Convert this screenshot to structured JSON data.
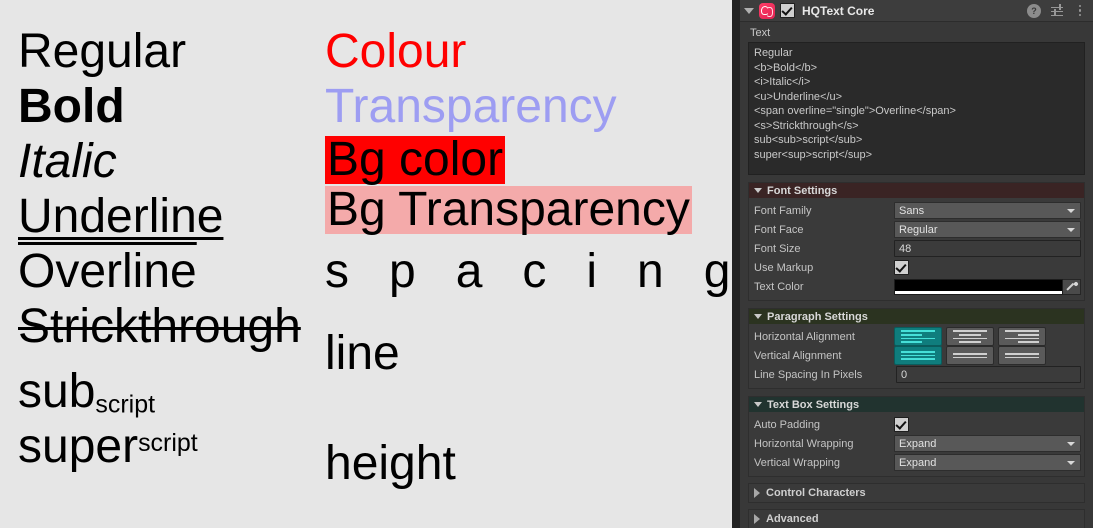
{
  "preview": {
    "background": "#e6e6e6",
    "samples_left": [
      {
        "id": "regular",
        "text": "Regular"
      },
      {
        "id": "bold",
        "text": "Bold"
      },
      {
        "id": "italic",
        "text": "Italic"
      },
      {
        "id": "underline",
        "text": "Underline"
      },
      {
        "id": "overline",
        "text": "Overline"
      },
      {
        "id": "strike",
        "text": "Strickthrough"
      }
    ],
    "subscript": {
      "base": "sub",
      "small": "script"
    },
    "superscript": {
      "base": "super",
      "small": "script"
    },
    "samples_right": [
      {
        "id": "colour",
        "text": "Colour",
        "color": "#ff0000"
      },
      {
        "id": "transparency",
        "text": "Transparency",
        "color": "#9d9df2"
      },
      {
        "id": "bg-color",
        "text": "Bg color",
        "bg": "#ff0000"
      },
      {
        "id": "bg-transparency",
        "text": "Bg Transparency",
        "bg": "#f4aaaa"
      },
      {
        "id": "spacing",
        "text": "spacing"
      },
      {
        "id": "line",
        "text": "line"
      },
      {
        "id": "height",
        "text": "height"
      }
    ]
  },
  "inspector": {
    "component_title": "HQText Core",
    "enabled": true,
    "icons": {
      "foldout": "triangle-down-icon",
      "component": "hqtext-icon",
      "help": "?",
      "preset": "preset-icon",
      "menu": "kebab-menu-icon"
    },
    "text_property": {
      "label": "Text",
      "value": "Regular\n<b>Bold</b>\n<i>Italic</i>\n<u>Underline</u>\n<span overline=\"single\">Overline</span>\n<s>Strickthrough</s>\nsub<sub>script</sub>\nsuper<sup>script</sup>"
    },
    "font_settings": {
      "title": "Font Settings",
      "header_color": "#3a2424",
      "rows": {
        "font_family_label": "Font Family",
        "font_family_value": "Sans",
        "font_face_label": "Font Face",
        "font_face_value": "Regular",
        "font_size_label": "Font Size",
        "font_size_value": "48",
        "use_markup_label": "Use Markup",
        "use_markup_checked": true,
        "text_color_label": "Text Color",
        "text_color_value": "#000000"
      }
    },
    "paragraph_settings": {
      "title": "Paragraph Settings",
      "header_color": "#2b3320",
      "horizontal_alignment_label": "Horizontal Alignment",
      "horizontal_alignment_selected": 0,
      "vertical_alignment_label": "Vertical Alignment",
      "vertical_alignment_selected": 0,
      "line_spacing_label": "Line Spacing In Pixels",
      "line_spacing_value": "0"
    },
    "text_box_settings": {
      "title": "Text Box Settings",
      "header_color": "#21332f",
      "auto_padding_label": "Auto Padding",
      "auto_padding_checked": true,
      "horizontal_wrapping_label": "Horizontal Wrapping",
      "horizontal_wrapping_value": "Expand",
      "vertical_wrapping_label": "Vertical Wrapping",
      "vertical_wrapping_value": "Expand"
    },
    "collapsed_sections": [
      {
        "title": "Control Characters"
      },
      {
        "title": "Advanced"
      }
    ]
  }
}
